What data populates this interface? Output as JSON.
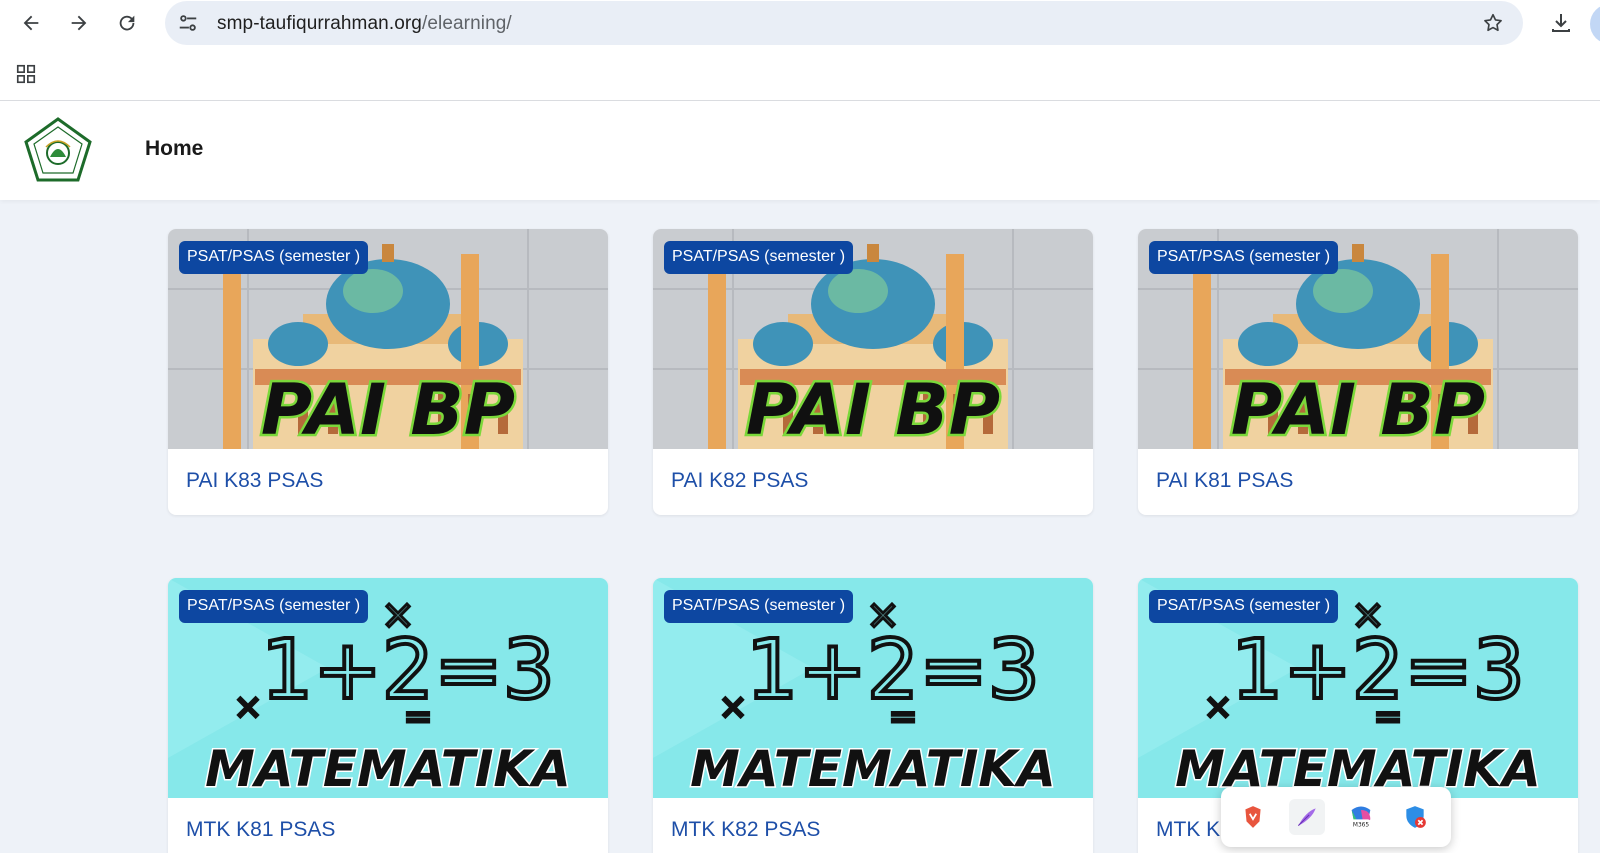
{
  "browser": {
    "url_host": "smp-taufiqurrahman.org",
    "url_path": "/elearning/"
  },
  "header": {
    "home_label": "Home"
  },
  "cards": [
    {
      "badge": "PSAT/PSAS (semester )",
      "title": "PAI K83 PSAS",
      "art": "PAI BP"
    },
    {
      "badge": "PSAT/PSAS (semester )",
      "title": "PAI K82 PSAS",
      "art": "PAI BP"
    },
    {
      "badge": "PSAT/PSAS (semester )",
      "title": "PAI K81 PSAS",
      "art": "PAI BP"
    },
    {
      "badge": "PSAT/PSAS (semester )",
      "title": "MTK K81 PSAS",
      "art": "MATEMATIKA",
      "art_formula": "1+2=3"
    },
    {
      "badge": "PSAT/PSAS (semester )",
      "title": "MTK K82 PSAS",
      "art": "MATEMATIKA",
      "art_formula": "1+2=3"
    },
    {
      "badge": "PSAT/PSAS (semester )",
      "title": "MTK K8",
      "art": "MATEMATIKA",
      "art_formula": "1+2=3"
    }
  ],
  "extension_popup": {
    "icons": [
      "brave-shield-icon",
      "feather-pen-icon",
      "m365-copilot-icon",
      "security-shield-icon"
    ],
    "m365_label": "M365"
  },
  "colors": {
    "badge_bg": "#0d47a1",
    "title_link": "#1e4fa8",
    "page_bg": "#eef2f8",
    "math_bg": "#86e8ea"
  }
}
